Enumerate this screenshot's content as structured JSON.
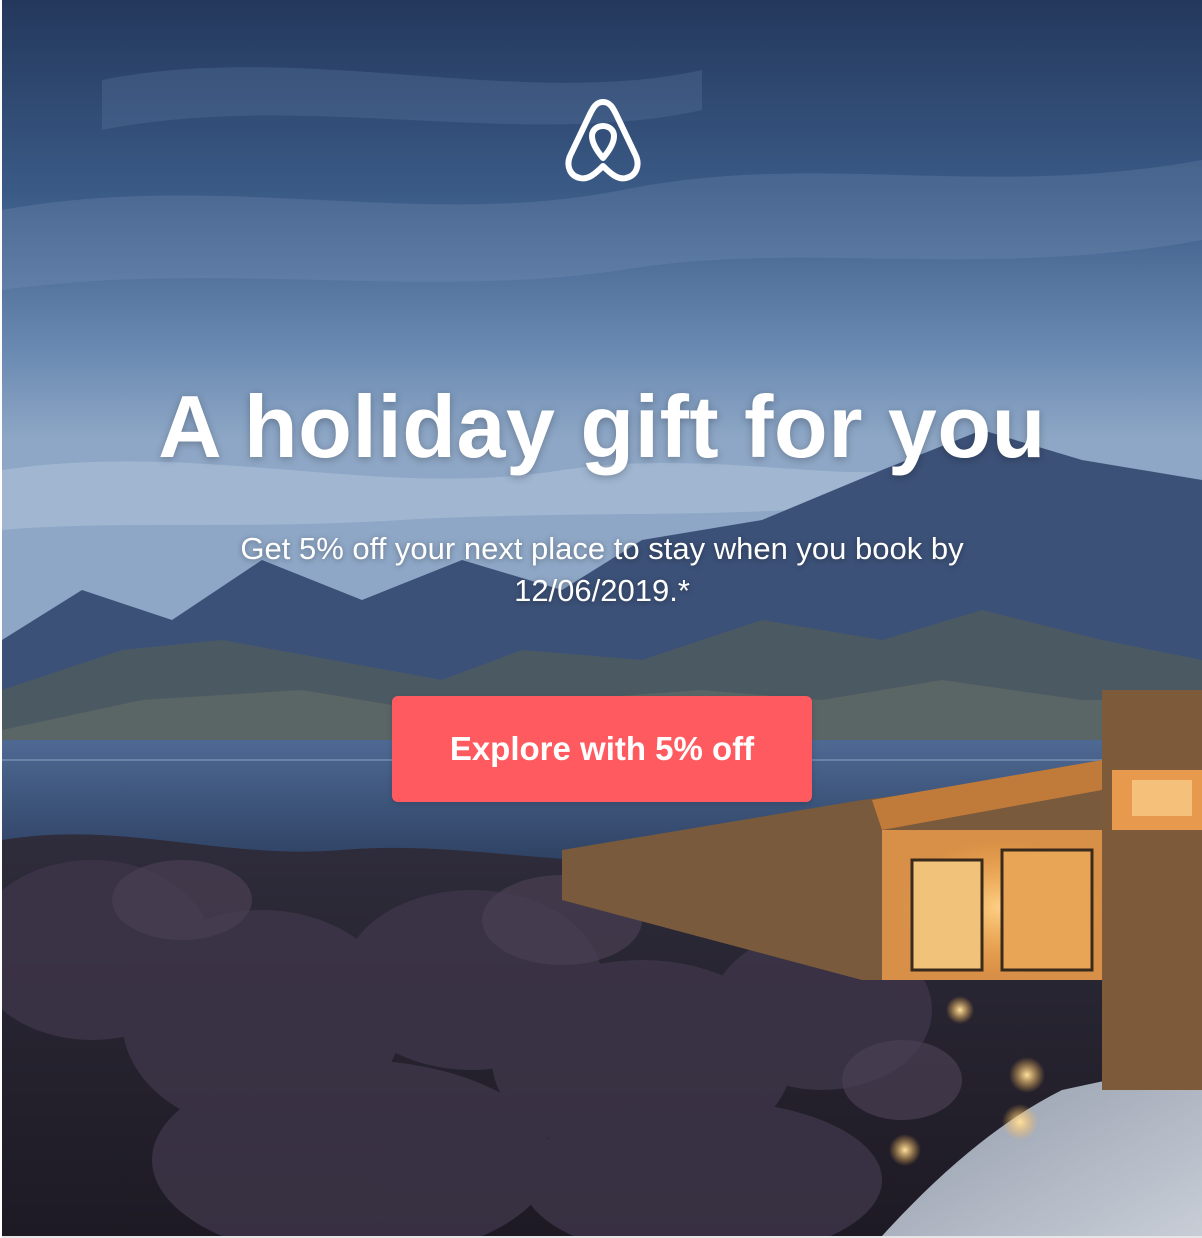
{
  "brand": {
    "logo_icon": "airbnb-belo-icon",
    "accent_color": "#ff5a5f"
  },
  "hero": {
    "headline": "A holiday gift for you",
    "subtext": "Get 5% off your next place to stay when you book by 12/06/2019.*",
    "cta_label": "Explore with 5% off",
    "background_image": "mountain-lake-house-at-dusk"
  }
}
